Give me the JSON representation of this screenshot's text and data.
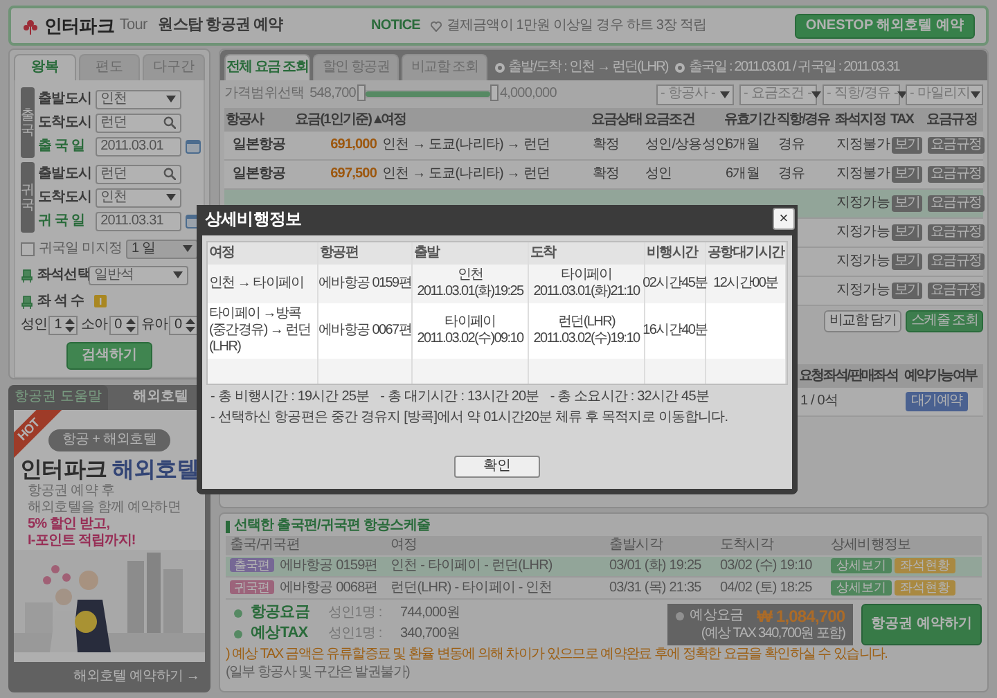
{
  "header": {
    "logo": "인터파크",
    "logo_sub": "Tour",
    "title": "원스탑 항공권 예약",
    "notice_label": "NOTICE",
    "notice": "결제금액이 1만원 이상일 경우 하트 3장 적립",
    "hotel_button": "ONESTOP 해외호텔 예약"
  },
  "search": {
    "tabs": [
      {
        "label": "왕복",
        "selected": true
      },
      {
        "label": "편도",
        "selected": false
      },
      {
        "label": "다구간",
        "selected": false
      }
    ],
    "legs": [
      {
        "label": "출국",
        "fields": [
          {
            "label": "출발도시",
            "value": "인천",
            "kind": "select"
          },
          {
            "label": "도착도시",
            "value": "런던",
            "kind": "search"
          },
          {
            "label": "출 국 일",
            "value": "2011.03.01",
            "kind": "date"
          }
        ]
      },
      {
        "label": "귀국",
        "fields": [
          {
            "label": "출발도시",
            "value": "런던",
            "kind": "search"
          },
          {
            "label": "도착도시",
            "value": "인천",
            "kind": "select"
          },
          {
            "label": "귀 국 일",
            "value": "2011.03.31",
            "kind": "date"
          }
        ]
      }
    ],
    "undecided": {
      "label": "귀국일 미지정",
      "checked": false,
      "value": "1 일"
    },
    "seat_class": {
      "label": "좌석선택",
      "value": "일반석"
    },
    "seat_count": {
      "label": "좌 석 수",
      "passengers": [
        {
          "label": "성인",
          "value": "1"
        },
        {
          "label": "소아",
          "value": "0"
        },
        {
          "label": "유아",
          "value": "0"
        }
      ]
    },
    "search_button": "검색하기"
  },
  "promo": {
    "tabs": [
      {
        "label": "항공권 도움말",
        "selected": false
      },
      {
        "label": "해외호텔",
        "selected": true
      }
    ],
    "badge": "HOT",
    "pill": "항공 + 해외호텔",
    "brand": "인터파크",
    "brand_accent": "해외호텔",
    "lines": [
      "항공권 예약 후",
      "해외호텔을 함께 예약하면"
    ],
    "highlights": [
      "5% 할인 받고,",
      "I-포인트 적립까지!"
    ],
    "link": "해외호텔 예약하기 →"
  },
  "results": {
    "tabs": [
      {
        "label": "전체 요금 조회",
        "selected": true
      },
      {
        "label": "할인 항공권",
        "selected": false
      },
      {
        "label": "비교함 조회",
        "selected": false
      }
    ],
    "route": "출발/도착 : 인천 → 런던(LHR)",
    "dates": "출국일 : 2011.03.01 / 귀국일 : 2011.03.31",
    "price_filter": {
      "label": "가격범위선택",
      "min": "548,700",
      "max": "4,000,000",
      "level": 1
    },
    "filters": [
      "- 항공사 -",
      "- 요금조건 -",
      "- 직항/경유 -",
      "- 마일리지"
    ],
    "columns": [
      "항공사",
      "요금(1인기준)▲",
      "여정",
      "요금상태",
      "요금조건",
      "유효기간",
      "직항/경유",
      "좌석지정",
      "TAX",
      "요금규정"
    ],
    "rows": [
      {
        "airline": "일본항공",
        "fare": "691,000",
        "route": "인천 → 도쿄(나리타) → 런던",
        "status": "확정",
        "condition": "성인/상용성인",
        "validity": "6개월",
        "stops": "경유",
        "seat": "지정불가",
        "tax": "보기",
        "rule": "요금규정",
        "selected": false
      },
      {
        "airline": "일본항공",
        "fare": "697,500",
        "route": "인천 → 도쿄(나리타) → 런던",
        "status": "확정",
        "condition": "성인",
        "validity": "6개월",
        "stops": "경유",
        "seat": "지정불가",
        "tax": "보기",
        "rule": "요금규정",
        "selected": false
      },
      {
        "seat": "지정가능",
        "tax": "보기",
        "rule": "요금규정",
        "selected": true
      },
      {
        "seat": "지정가능",
        "tax": "보기",
        "rule": "요금규정",
        "selected": false
      },
      {
        "seat": "지정가능",
        "tax": "보기",
        "rule": "요금규정",
        "selected": false
      },
      {
        "seat": "지정가능",
        "tax": "보기",
        "rule": "요금규정",
        "selected": false
      }
    ],
    "actions": [
      "비교함 담기",
      "스케줄 조회"
    ],
    "availability": {
      "columns": [
        "요청좌석/판매좌석",
        "예약가능여부"
      ],
      "seats": "1 / 0석",
      "button": "대기예약"
    }
  },
  "schedule": {
    "title": "선택한 출국편/귀국편 항공스케줄",
    "columns": [
      "출국/귀국편",
      "여정",
      "출발시각",
      "도착시각",
      "상세비행정보"
    ],
    "rows": [
      {
        "leg": "출국편",
        "kind": "outbound",
        "flight": "에바항공 0159편",
        "route": "인천 - 타이페이 - 런던(LHR)",
        "depart": "03/01 (화) 19:25",
        "arrive": "03/02 (수) 19:10",
        "detail": "상세보기",
        "seats": "좌석현황",
        "selected": true
      },
      {
        "leg": "귀국편",
        "kind": "return",
        "flight": "에바항공 0068편",
        "route": "런던(LHR) - 타이페이 - 인천",
        "depart": "03/31 (목) 21:35",
        "arrive": "04/02 (토) 18:25",
        "detail": "상세보기",
        "seats": "좌석현황",
        "selected": false
      }
    ],
    "prices": [
      {
        "label": "항공요금",
        "note": "성인1명 :",
        "amount": "744,000원"
      },
      {
        "label": "예상TAX",
        "note": "성인1명 :",
        "amount": "340,700원"
      }
    ],
    "total": {
      "label": "예상요금",
      "amount": "₩ 1,084,700",
      "note": "(예상 TAX 340,700원 포함)"
    },
    "book_button": "항공권 예약하기",
    "notice": ") 예상 TAX 금액은 유류할증료 및 환율 변동에 의해 차이가 있으므로 예약완료 후에 정확한 요금을 확인하실 수 있습니다.",
    "notice_tail": "(일부 항공사 및 구간은 발권불가)"
  },
  "dialog": {
    "title": "상세비행정보",
    "close": "×",
    "columns": [
      "여정",
      "항공편",
      "출발",
      "도착",
      "비행시간",
      "공항대기시간"
    ],
    "rows": [
      {
        "route": "인천 → 타이페이",
        "flight": "에바항공 0159편",
        "depart_place": "인천",
        "depart_time": "2011.03.01(화)19:25",
        "arrive_place": "타이페이",
        "arrive_time": "2011.03.01(화)21:10",
        "duration": "02시간45분",
        "wait": "12시간00분"
      },
      {
        "route": "타이페이 →방콕(중간경유) → 런던(LHR)",
        "flight": "에바항공 0067편",
        "depart_place": "타이페이",
        "depart_time": "2011.03.02(수)09:10",
        "arrive_place": "런던(LHR)",
        "arrive_time": "2011.03.02(수)19:10",
        "duration": "16시간40분"
      }
    ],
    "summary": [
      "- 총 비행시간 : 19시간 25분",
      "- 총 대기시간 : 13시간 20분",
      "- 총 소요시간 : 32시간 45분"
    ],
    "note": "- 선택하신 항공편은 중간 경유지 [방콕]에서 약 01시간20분 체류 후 목적지로 이동합니다.",
    "ok_button": "확인"
  }
}
